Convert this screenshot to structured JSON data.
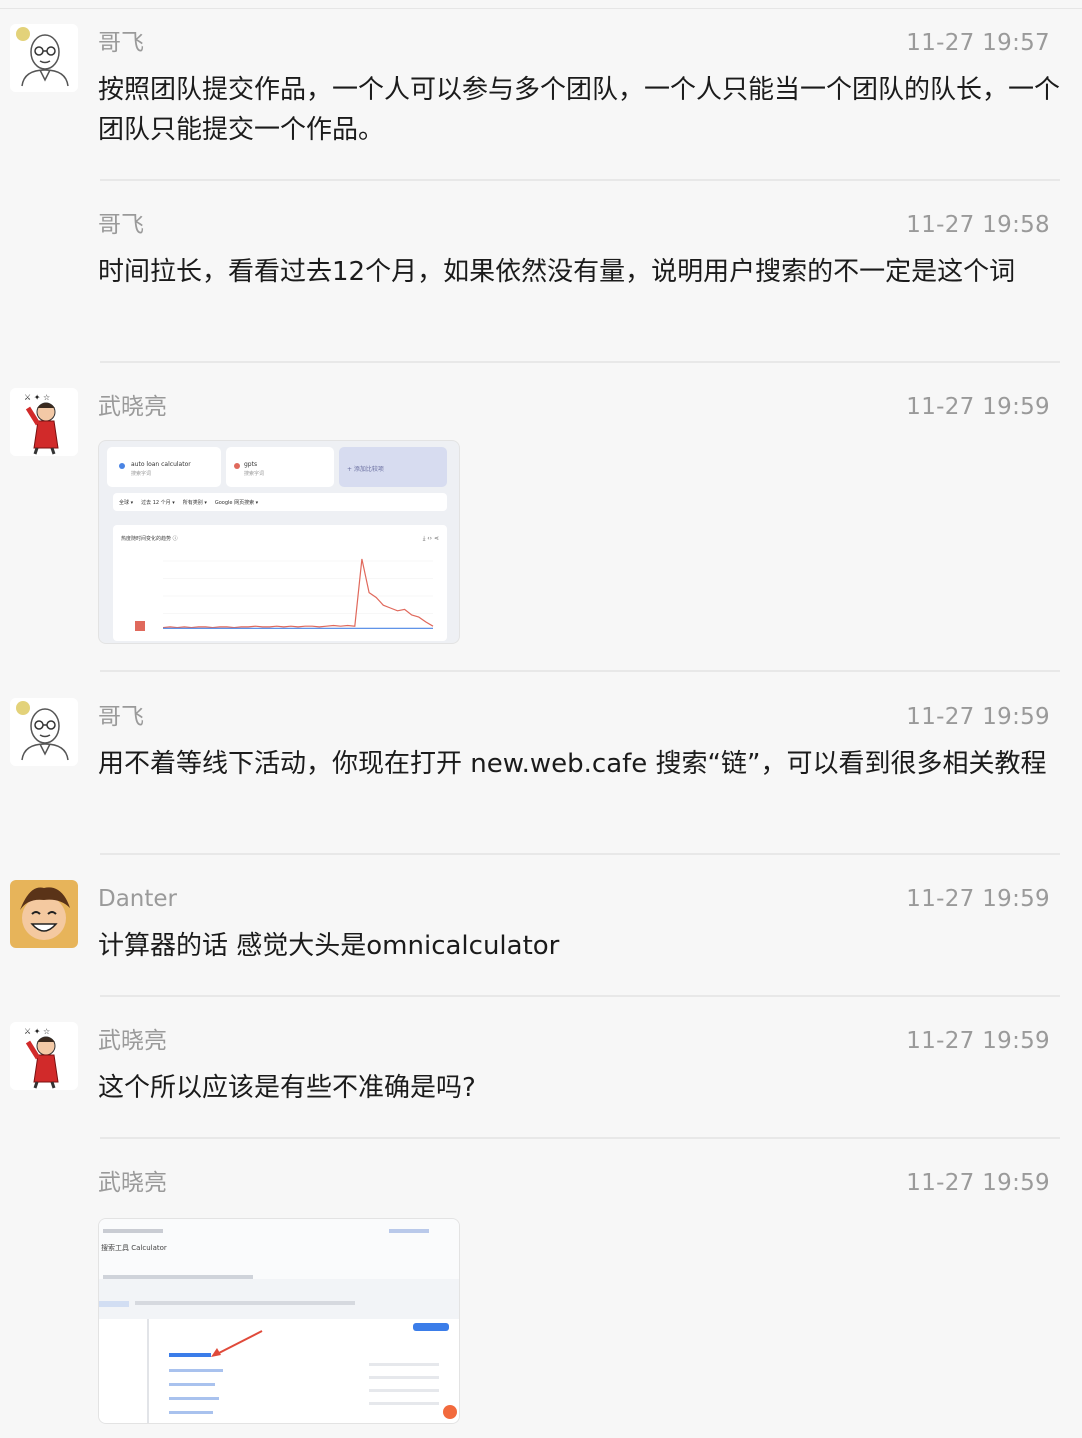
{
  "messages": [
    {
      "sender": "哥飞",
      "time": "11-27 19:57",
      "text": "按照团队提交作品，一个人可以参与多个团队，一个人只能当一个团队的队长，一个团队只能提交一个作品。"
    },
    {
      "sender": "哥飞",
      "time": "11-27 19:58",
      "text": "时间拉长，看看过去12个月，如果依然没有量，说明用户搜索的不一定是这个词"
    },
    {
      "sender": "武晓亮",
      "time": "11-27 19:59"
    },
    {
      "sender": "哥飞",
      "time": "11-27 19:59",
      "text": "用不着等线下活动，你现在打开 new.web.cafe 搜索“链”，可以看到很多相关教程"
    },
    {
      "sender": "Danter",
      "time": "11-27 19:59",
      "text": "计算器的话 感觉大头是omnicalculator"
    },
    {
      "sender": "武晓亮",
      "time": "11-27 19:59",
      "text": "这个所以应该是有些不准确是吗?"
    },
    {
      "sender": "武晓亮",
      "time": "11-27 19:59"
    }
  ],
  "trends_image": {
    "term1": "auto loan calculator",
    "term1_sub": "搜索字词",
    "term2": "gpts",
    "term2_sub": "搜索字词",
    "add_compare": "+ 添加比较项",
    "filters": [
      "全球 ▾",
      "过去 12 个月 ▾",
      "所有类别 ▾",
      "Google 网页搜索 ▾"
    ],
    "chart_title": "热度随时间变化的趋势 ⓘ",
    "chart_data": {
      "type": "line",
      "series": [
        {
          "color": "#e0695c",
          "values": [
            2,
            3,
            2,
            3,
            2,
            3,
            3,
            2,
            3,
            3,
            2,
            3,
            3,
            4,
            3,
            3,
            4,
            3,
            4,
            3,
            4,
            4,
            3,
            4,
            5,
            4,
            5,
            4,
            100,
            52,
            45,
            34,
            30,
            26,
            28,
            20,
            17,
            10,
            4
          ]
        },
        {
          "color": "#4a84e4",
          "values": [
            1,
            1,
            1,
            1,
            1,
            1,
            1,
            1,
            1,
            1,
            1,
            1,
            1,
            1,
            1,
            1,
            1,
            1,
            1,
            1,
            1,
            1,
            1,
            1,
            1,
            1,
            1,
            1,
            1,
            1,
            1,
            1,
            1,
            1,
            1,
            1,
            1,
            1,
            1
          ]
        }
      ]
    }
  },
  "table_image": {
    "title": "搜索工具 Calculator"
  },
  "colors": {
    "name": "#9a9a9a",
    "text": "#1b1b1b",
    "divider": "#e8e8e8",
    "accent_red": "#e0695c",
    "accent_blue": "#4a84e4"
  }
}
